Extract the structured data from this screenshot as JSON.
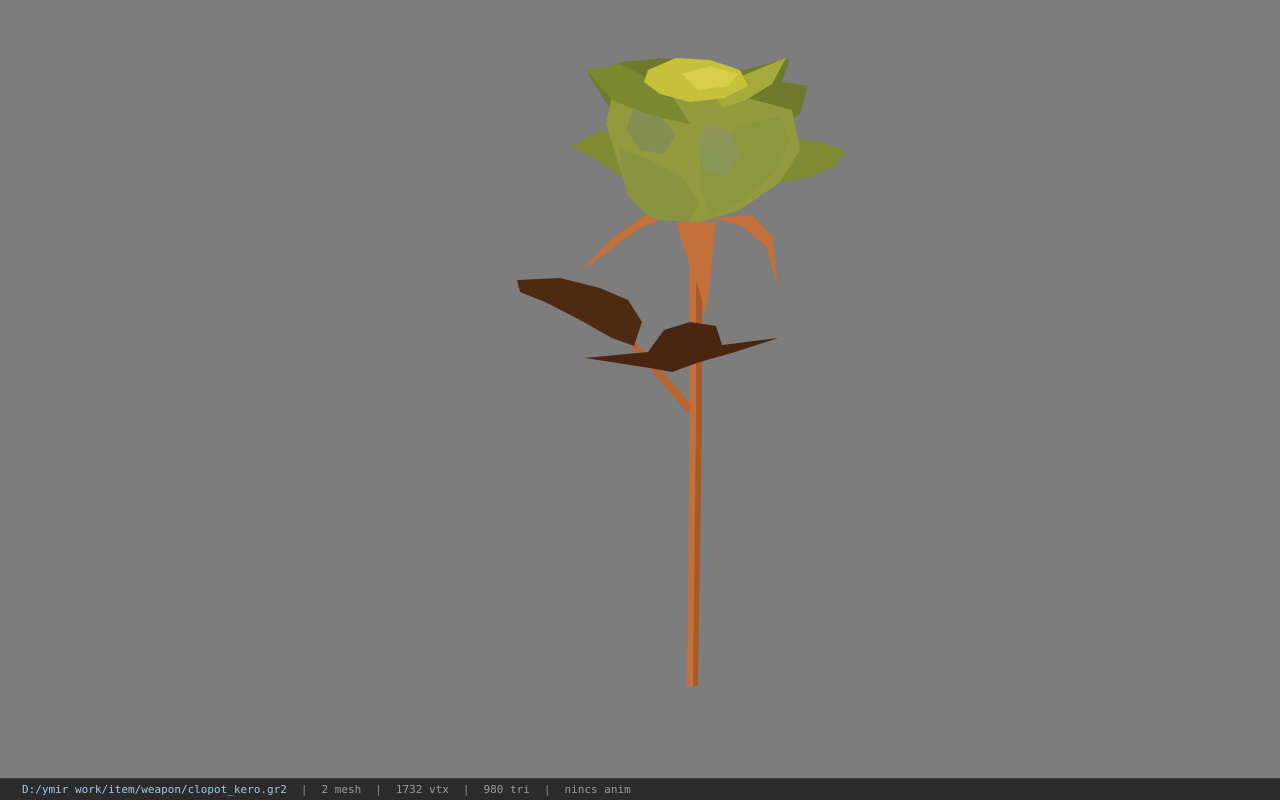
{
  "viewport": {
    "background": "#7d7d7d",
    "model": "rose"
  },
  "status_bar": {
    "file_path": "D:/ymir work/item/weapon/clopot_kero.gr2",
    "separator": "|",
    "mesh_count": "2 mesh",
    "vertex_count": "1732 vtx",
    "triangle_count": "980 tri",
    "animation": "nincs anim"
  },
  "colors": {
    "petal_light": "#c7c13a",
    "petal_mid": "#9a9a3c",
    "petal_dark": "#6f7a2e",
    "stem": "#c4703a",
    "leaf": "#4e2a10",
    "status_bg": "#2b2b2b",
    "path_text": "#9ec8de"
  }
}
